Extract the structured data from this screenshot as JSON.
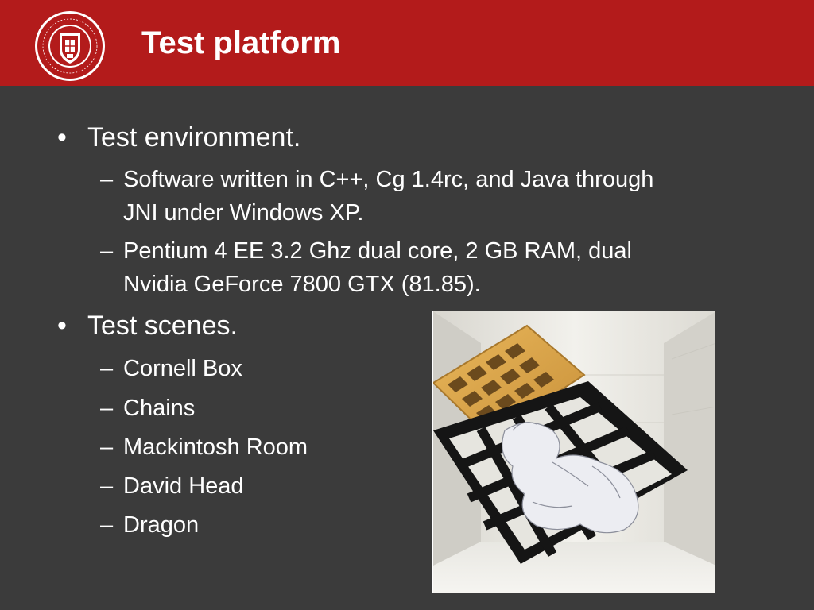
{
  "header": {
    "title": "Test platform",
    "logo_alt_text": "CORNELL UNIVERSITY FOUNDED A.D. 1865"
  },
  "bullets": [
    {
      "text": "Test environment.",
      "subitems": [
        {
          "lines": [
            "Software written in C++, Cg 1.4rc, and Java through",
            "JNI under Windows XP."
          ]
        },
        {
          "lines": [
            "Pentium 4 EE 3.2 Ghz dual core, 2 GB RAM, dual",
            "Nvidia GeForce 7800 GTX (81.85)."
          ]
        }
      ]
    },
    {
      "text": "Test scenes.",
      "subitems": [
        {
          "lines": [
            "Cornell Box"
          ]
        },
        {
          "lines": [
            "Chains"
          ]
        },
        {
          "lines": [
            "Mackintosh Room"
          ]
        },
        {
          "lines": [
            "David Head"
          ]
        },
        {
          "lines": [
            "Dragon"
          ]
        }
      ]
    }
  ],
  "markers": {
    "level1": "•",
    "level2": "–"
  },
  "colors": {
    "header_bg": "#b31b1b",
    "slide_bg": "#3b3b3b",
    "text": "#ffffff"
  },
  "figure": {
    "icon": "dragon-render-image"
  }
}
